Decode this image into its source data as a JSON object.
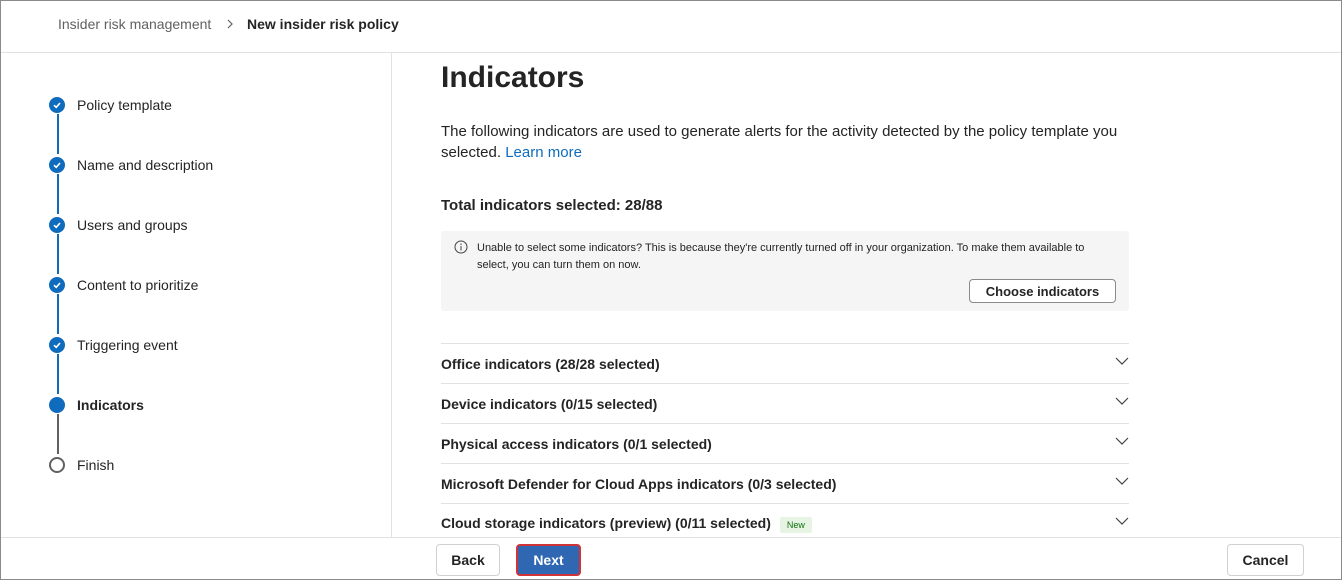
{
  "breadcrumb": {
    "root": "Insider risk management",
    "current": "New insider risk policy"
  },
  "steps": [
    {
      "label": "Policy template",
      "state": "complete"
    },
    {
      "label": "Name and description",
      "state": "complete"
    },
    {
      "label": "Users and groups",
      "state": "complete"
    },
    {
      "label": "Content to prioritize",
      "state": "complete"
    },
    {
      "label": "Triggering event",
      "state": "complete"
    },
    {
      "label": "Indicators",
      "state": "current"
    },
    {
      "label": "Finish",
      "state": "pending"
    }
  ],
  "main": {
    "title": "Indicators",
    "description": "The following indicators are used to generate alerts for the activity detected by the policy template you selected.",
    "learn_more": "Learn more",
    "total_selected": "Total indicators selected: 28/88",
    "info_message": "Unable to select some indicators? This is because they're currently turned off in your organization. To make them available to select, you can turn them on now.",
    "choose_indicators_label": "Choose indicators",
    "accordion": [
      {
        "label": "Office indicators (28/28 selected)"
      },
      {
        "label": "Device indicators (0/15 selected)"
      },
      {
        "label": "Physical access indicators (0/1 selected)"
      },
      {
        "label": "Microsoft Defender for Cloud Apps indicators (0/3 selected)"
      },
      {
        "label": "Cloud storage indicators (preview) (0/11 selected)",
        "badge": "New"
      }
    ]
  },
  "footer": {
    "back_label": "Back",
    "next_label": "Next",
    "cancel_label": "Cancel"
  },
  "colors": {
    "accent": "#0f6cbd",
    "next_button": "#2f67b3",
    "next_highlight_border": "#d13438",
    "new_badge_bg": "#e7f4e4"
  }
}
